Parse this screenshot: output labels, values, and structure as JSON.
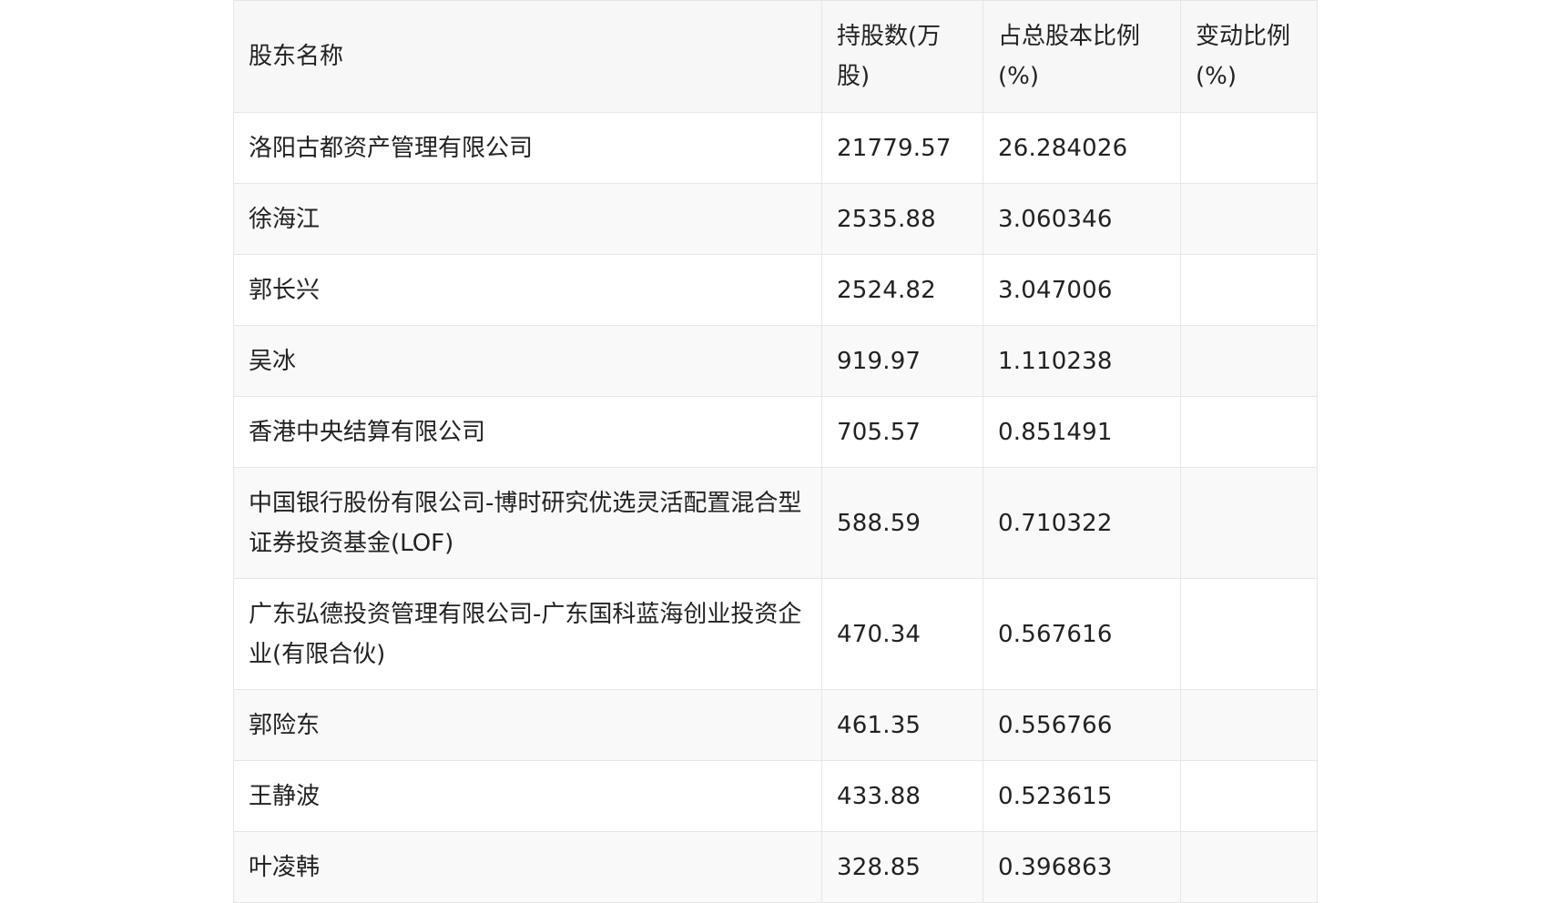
{
  "table": {
    "headers": {
      "name": "股东名称",
      "shares": "持股数(万股)",
      "ratio": "占总股本比例(%)",
      "change": "变动比例(%)"
    },
    "rows": [
      {
        "name": "洛阳古都资产管理有限公司",
        "shares": "21779.57",
        "ratio": "26.284026",
        "change": ""
      },
      {
        "name": "徐海江",
        "shares": "2535.88",
        "ratio": "3.060346",
        "change": ""
      },
      {
        "name": "郭长兴",
        "shares": "2524.82",
        "ratio": "3.047006",
        "change": ""
      },
      {
        "name": "吴冰",
        "shares": "919.97",
        "ratio": "1.110238",
        "change": ""
      },
      {
        "name": "香港中央结算有限公司",
        "shares": "705.57",
        "ratio": "0.851491",
        "change": ""
      },
      {
        "name": "中国银行股份有限公司-博时研究优选灵活配置混合型证券投资基金(LOF)",
        "shares": "588.59",
        "ratio": "0.710322",
        "change": ""
      },
      {
        "name": "广东弘德投资管理有限公司-广东国科蓝海创业投资企业(有限合伙)",
        "shares": "470.34",
        "ratio": "0.567616",
        "change": ""
      },
      {
        "name": "郭险东",
        "shares": "461.35",
        "ratio": "0.556766",
        "change": ""
      },
      {
        "name": "王静波",
        "shares": "433.88",
        "ratio": "0.523615",
        "change": ""
      },
      {
        "name": "叶凌韩",
        "shares": "328.85",
        "ratio": "0.396863",
        "change": ""
      }
    ]
  }
}
